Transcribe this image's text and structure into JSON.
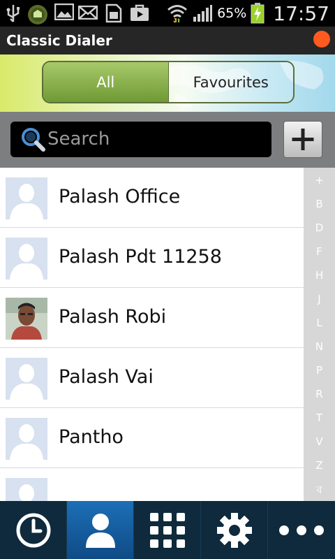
{
  "status_bar": {
    "battery_percent": "65%",
    "time": "17:57",
    "icons": [
      "usb-icon",
      "badge-icon",
      "gallery-icon",
      "mail-icon",
      "sim-icon",
      "bag-icon",
      "wifi-icon",
      "signal-icon",
      "battery-charging-icon"
    ]
  },
  "title_bar": {
    "title": "Classic Dialer"
  },
  "tabs": [
    {
      "label": "All",
      "active": true
    },
    {
      "label": "Favourites",
      "active": false
    }
  ],
  "search": {
    "placeholder": "Search",
    "value": ""
  },
  "contacts": [
    {
      "name": "Palash Office",
      "avatar": "placeholder"
    },
    {
      "name": "Palash Pdt 11258",
      "avatar": "placeholder"
    },
    {
      "name": "Palash Robi",
      "avatar": "photo"
    },
    {
      "name": "Palash Vai",
      "avatar": "placeholder"
    },
    {
      "name": "Pantho",
      "avatar": "placeholder"
    },
    {
      "name": "",
      "avatar": "placeholder"
    }
  ],
  "index_letters": [
    "+",
    "B",
    "D",
    "F",
    "H",
    "J",
    "L",
    "N",
    "P",
    "R",
    "T",
    "V",
    "Z",
    "ব"
  ],
  "bottom_nav": [
    {
      "name": "recent",
      "icon": "clock-icon",
      "active": false
    },
    {
      "name": "contacts",
      "icon": "person-icon",
      "active": true
    },
    {
      "name": "dialpad",
      "icon": "dialpad-icon",
      "active": false
    },
    {
      "name": "settings",
      "icon": "gear-icon",
      "active": false
    },
    {
      "name": "more",
      "icon": "more-icon",
      "active": false
    }
  ],
  "colors": {
    "active_tab": "#6f9a34",
    "nav_active": "#1c6fb6",
    "nav_bg": "#0e2a3c",
    "status_dot": "#ff5a1f"
  }
}
